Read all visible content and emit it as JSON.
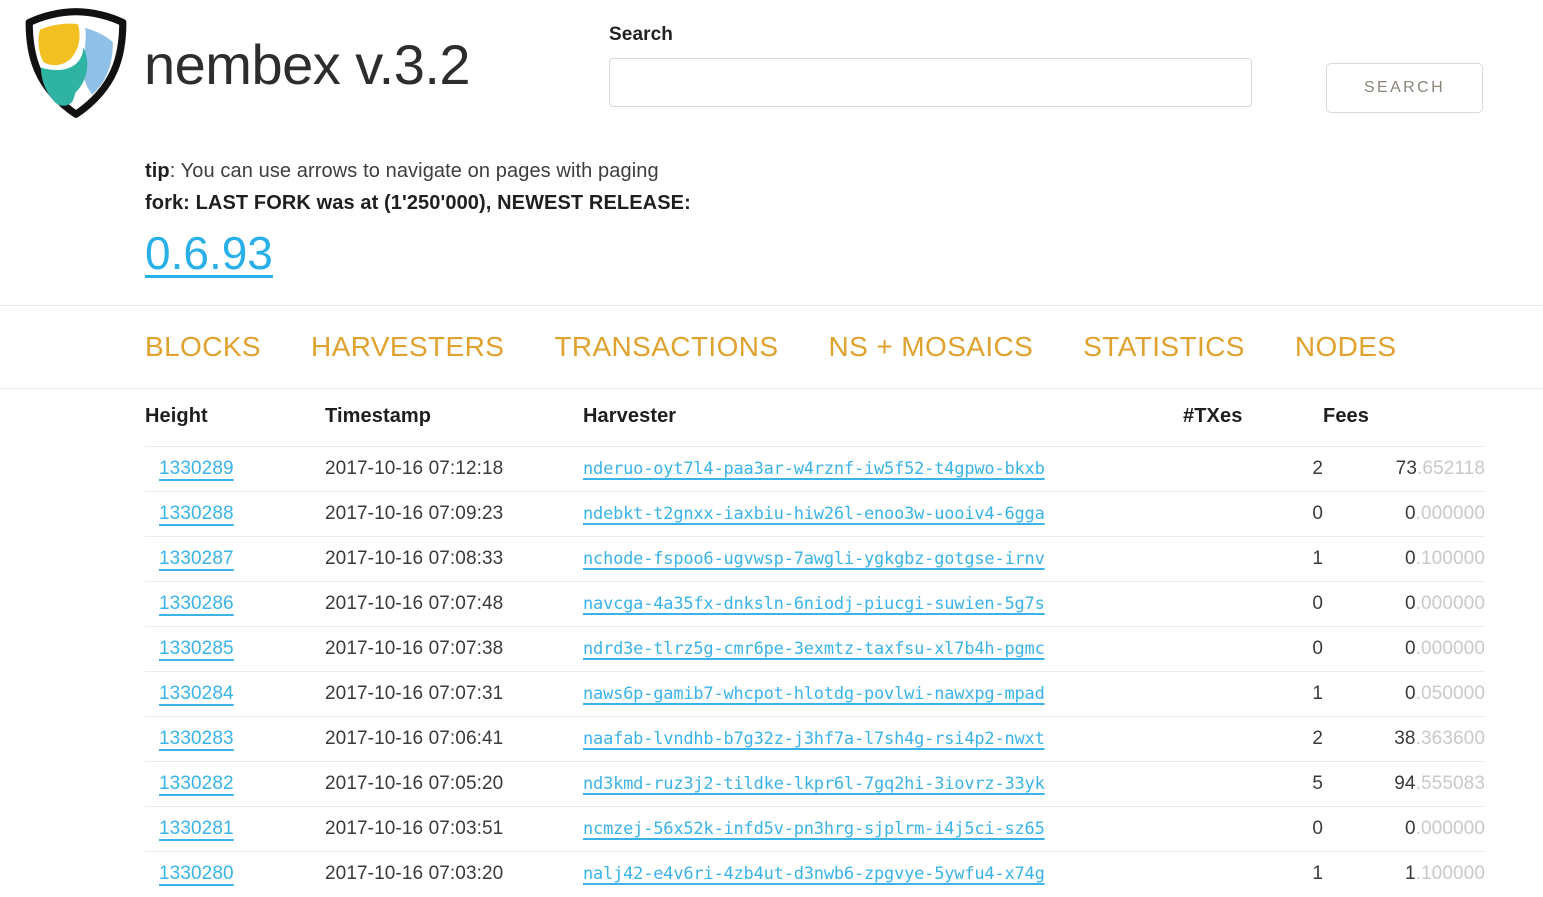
{
  "brand": {
    "title": "nembex v.3.2",
    "logo_icon": "nem-shield-logo",
    "logo_colors": {
      "yellow": "#f2c021",
      "blue": "#8fc0e8",
      "teal": "#2fb3a3",
      "outline": "#111111"
    }
  },
  "search": {
    "label": "Search",
    "value": "",
    "placeholder": "",
    "button_label": "SEARCH"
  },
  "notices": {
    "tip_label": "tip",
    "tip_text": ": You can use arrows to navigate on pages with paging",
    "fork_text": "fork: LAST FORK was at (1'250'000), NEWEST RELEASE:",
    "release_version": "0.6.93"
  },
  "nav": {
    "items": [
      {
        "label": "BLOCKS"
      },
      {
        "label": "HARVESTERS"
      },
      {
        "label": "TRANSACTIONS"
      },
      {
        "label": "NS + MOSAICS"
      },
      {
        "label": "STATISTICS"
      },
      {
        "label": "NODES"
      }
    ],
    "accent_color": "#e0a22f"
  },
  "table": {
    "headers": {
      "height": "Height",
      "timestamp": "Timestamp",
      "harvester": "Harvester",
      "txes": "#TXes",
      "fees": "Fees"
    },
    "rows": [
      {
        "height": "1330289",
        "timestamp": "2017-10-16 07:12:18",
        "harvester": "nderuo-oyt7l4-paa3ar-w4rznf-iw5f52-t4gpwo-bkxb",
        "txes": "2",
        "fee_int": "73",
        "fee_dec": ".652118"
      },
      {
        "height": "1330288",
        "timestamp": "2017-10-16 07:09:23",
        "harvester": "ndebkt-t2gnxx-iaxbiu-hiw26l-enoo3w-uooiv4-6gga",
        "txes": "0",
        "fee_int": "0",
        "fee_dec": ".000000"
      },
      {
        "height": "1330287",
        "timestamp": "2017-10-16 07:08:33",
        "harvester": "nchode-fspoo6-ugvwsp-7awgli-ygkgbz-gotgse-irnv",
        "txes": "1",
        "fee_int": "0",
        "fee_dec": ".100000"
      },
      {
        "height": "1330286",
        "timestamp": "2017-10-16 07:07:48",
        "harvester": "navcga-4a35fx-dnksln-6niodj-piucgi-suwien-5g7s",
        "txes": "0",
        "fee_int": "0",
        "fee_dec": ".000000"
      },
      {
        "height": "1330285",
        "timestamp": "2017-10-16 07:07:38",
        "harvester": "ndrd3e-tlrz5g-cmr6pe-3exmtz-taxfsu-xl7b4h-pgmc",
        "txes": "0",
        "fee_int": "0",
        "fee_dec": ".000000"
      },
      {
        "height": "1330284",
        "timestamp": "2017-10-16 07:07:31",
        "harvester": "naws6p-gamib7-whcpot-hlotdg-povlwi-nawxpg-mpad",
        "txes": "1",
        "fee_int": "0",
        "fee_dec": ".050000"
      },
      {
        "height": "1330283",
        "timestamp": "2017-10-16 07:06:41",
        "harvester": "naafab-lvndhb-b7g32z-j3hf7a-l7sh4g-rsi4p2-nwxt",
        "txes": "2",
        "fee_int": "38",
        "fee_dec": ".363600"
      },
      {
        "height": "1330282",
        "timestamp": "2017-10-16 07:05:20",
        "harvester": "nd3kmd-ruz3j2-tildke-lkpr6l-7gq2hi-3iovrz-33yk",
        "txes": "5",
        "fee_int": "94",
        "fee_dec": ".555083"
      },
      {
        "height": "1330281",
        "timestamp": "2017-10-16 07:03:51",
        "harvester": "ncmzej-56x52k-infd5v-pn3hrg-sjplrm-i4j5ci-sz65",
        "txes": "0",
        "fee_int": "0",
        "fee_dec": ".000000"
      },
      {
        "height": "1330280",
        "timestamp": "2017-10-16 07:03:20",
        "harvester": "nalj42-e4v6ri-4zb4ut-d3nwb6-zpgvye-5ywfu4-x74g",
        "txes": "1",
        "fee_int": "1",
        "fee_dec": ".100000"
      }
    ]
  },
  "colors": {
    "link_blue": "#3ab3e8",
    "release_blue": "#29b0e8",
    "nav_amber": "#e0a22f",
    "fee_decimal_gray": "#c9c9c9",
    "row_divider": "#ececec"
  }
}
